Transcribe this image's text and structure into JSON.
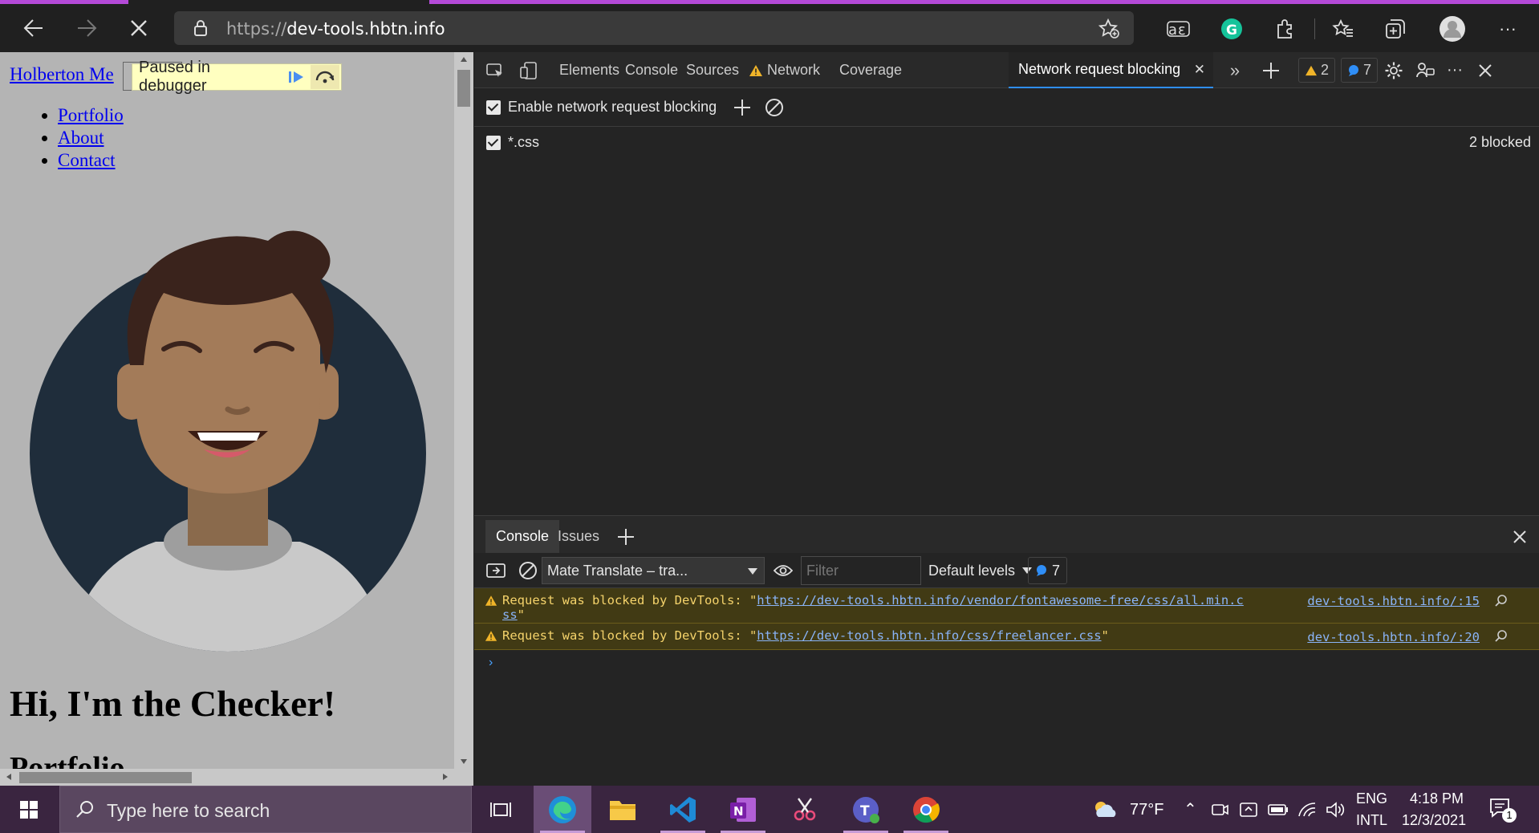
{
  "browser": {
    "url_prefix": "https://",
    "url_host": "dev-tools.hbtn.info",
    "icons": [
      "back-icon",
      "forward-icon",
      "stop-icon",
      "lock-icon",
      "favorite-add-icon",
      "immersive-reader-icon",
      "grammarly-icon",
      "extensions-icon",
      "favorites-icon",
      "collections-icon",
      "profile-icon",
      "more-icon"
    ]
  },
  "page": {
    "site_title": "Holberton Me",
    "paused_label": "Paused in debugger",
    "nav": [
      "Portfolio",
      "About",
      "Contact"
    ],
    "heading": "Hi, I'm the Checker!",
    "next_heading": "Portfolio"
  },
  "devtools": {
    "tabs": [
      "Elements",
      "Console",
      "Sources",
      "Network",
      "Coverage",
      "Network request blocking"
    ],
    "active_tab": "Network request blocking",
    "warnings_count": "2",
    "messages_count": "7",
    "enable_label": "Enable network request blocking",
    "patterns": [
      {
        "pattern": "*.css",
        "status": "2 blocked",
        "checked": true
      }
    ],
    "colors": {
      "accent": "#2f8ef7",
      "warning": "#f5d36b",
      "warning_bg": "#413a14"
    }
  },
  "drawer": {
    "tabs": [
      "Console",
      "Issues"
    ],
    "context": "Mate Translate – tra...",
    "filter_placeholder": "Filter",
    "levels": "Default levels",
    "messages_count": "7",
    "messages": [
      {
        "prefix": "Request was blocked by DevTools: \"",
        "link_line1": "https://dev-tools.hbtn.info/vendor/fontawesome-free/css/all.min.c",
        "link_line2": "ss",
        "suffix": "\"",
        "source": "dev-tools.hbtn.info/:15"
      },
      {
        "prefix": "Request was blocked by DevTools: \"",
        "link": "https://dev-tools.hbtn.info/css/freelancer.css",
        "suffix": "\"",
        "source": "dev-tools.hbtn.info/:20"
      }
    ]
  },
  "taskbar": {
    "search_placeholder": "Type here to search",
    "weather": "77°F",
    "lang1": "ENG",
    "lang2": "INTL",
    "time": "4:18 PM",
    "date": "12/3/2021",
    "notifications": "1",
    "apps": [
      "task-view-icon",
      "edge-icon",
      "file-explorer-icon",
      "vscode-icon",
      "onenote-icon",
      "snip-icon",
      "teams-icon",
      "chrome-icon"
    ]
  }
}
